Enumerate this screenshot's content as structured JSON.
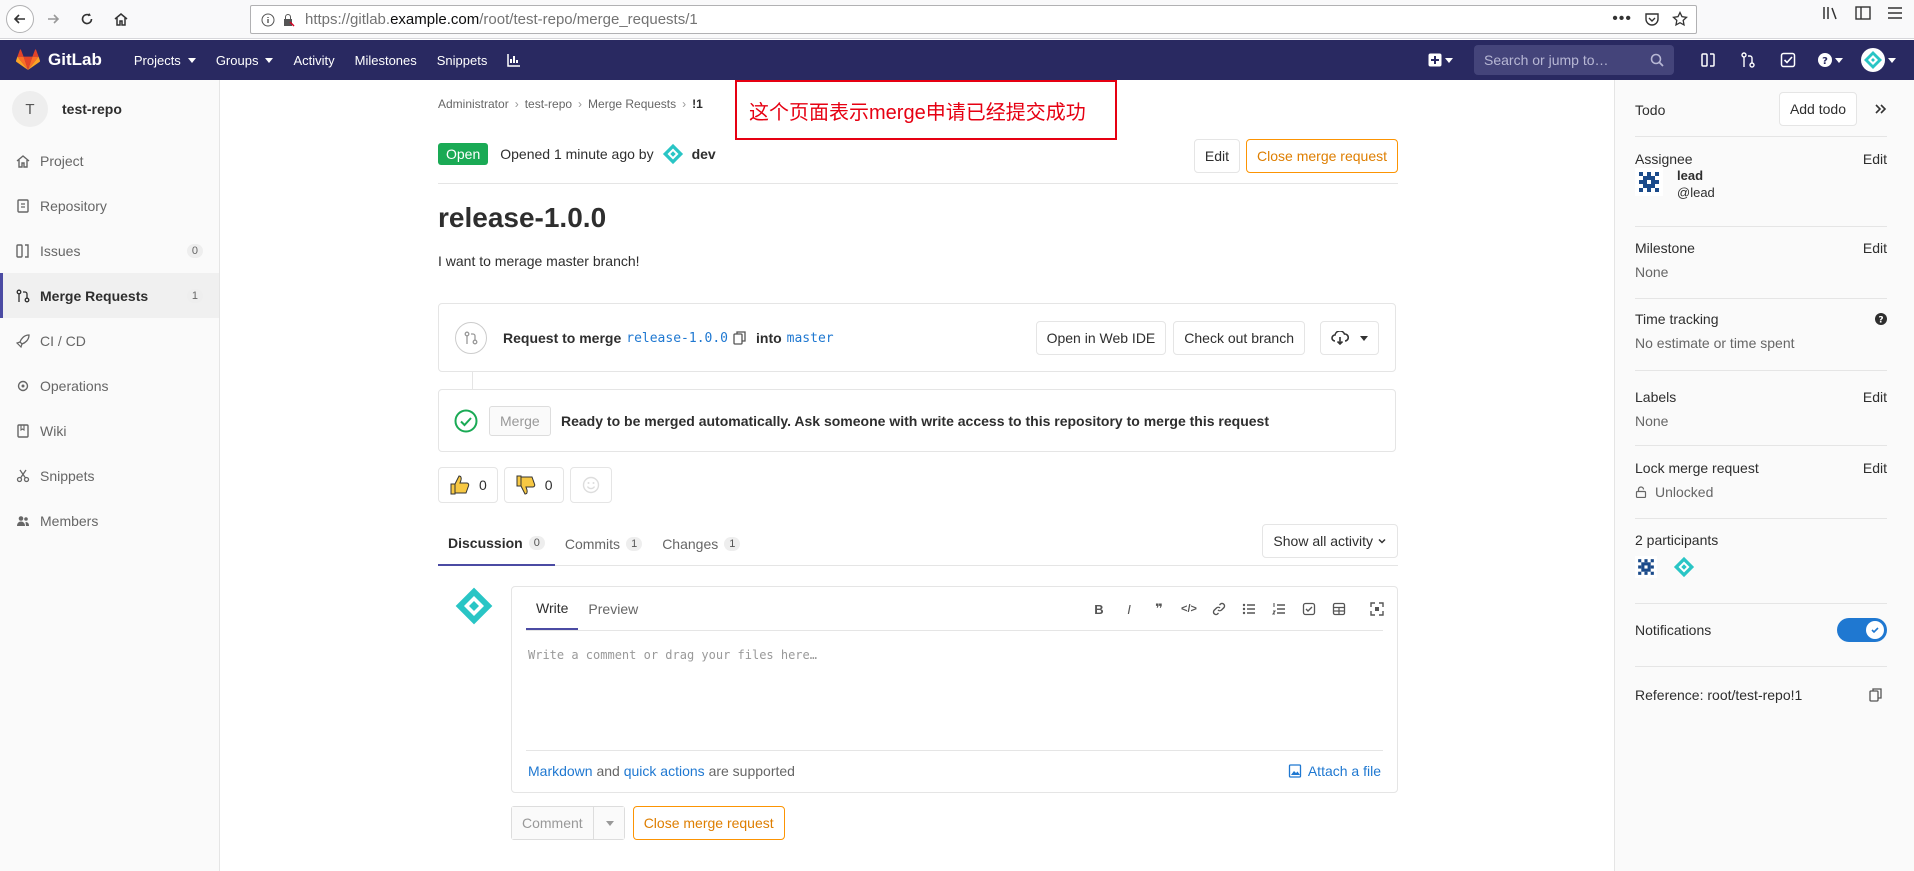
{
  "browser": {
    "url_prefix": "https://gitlab.",
    "url_host": "example.com",
    "url_path": "/root/test-repo/merge_requests/1"
  },
  "header": {
    "brand": "GitLab",
    "nav": [
      "Projects",
      "Groups",
      "Activity",
      "Milestones",
      "Snippets"
    ],
    "search_placeholder": "Search or jump to…"
  },
  "sidebar": {
    "project_initial": "T",
    "project_name": "test-repo",
    "items": [
      {
        "label": "Project"
      },
      {
        "label": "Repository"
      },
      {
        "label": "Issues",
        "count": "0"
      },
      {
        "label": "Merge Requests",
        "count": "1"
      },
      {
        "label": "CI / CD"
      },
      {
        "label": "Operations"
      },
      {
        "label": "Wiki"
      },
      {
        "label": "Snippets"
      },
      {
        "label": "Members"
      }
    ]
  },
  "breadcrumb": [
    "Administrator",
    "test-repo",
    "Merge Requests",
    "!1"
  ],
  "annotation": "这个页面表示merge申请已经提交成功",
  "mr": {
    "status": "Open",
    "opened_text": "Opened 1 minute ago by",
    "author": "dev",
    "edit_label": "Edit",
    "close_label": "Close merge request",
    "title": "release-1.0.0",
    "description": "I want to merage master branch!",
    "request_prefix": "Request to merge",
    "source_branch": "release-1.0.0",
    "into_label": "into",
    "target_branch": "master",
    "open_ide_label": "Open in Web IDE",
    "checkout_label": "Check out branch",
    "merge_label": "Merge",
    "merge_status": "Ready to be merged automatically. Ask someone with write access to this repository to merge this request",
    "thumbs_up": "0",
    "thumbs_down": "0"
  },
  "tabs": [
    {
      "label": "Discussion",
      "count": "0"
    },
    {
      "label": "Commits",
      "count": "1"
    },
    {
      "label": "Changes",
      "count": "1"
    }
  ],
  "activity_label": "Show all activity",
  "editor": {
    "write_label": "Write",
    "preview_label": "Preview",
    "placeholder": "Write a comment or drag your files here…",
    "markdown_label": "Markdown",
    "and_label": "and",
    "quick_actions_label": "quick actions",
    "supported_label": "are supported",
    "attach_label": "Attach a file",
    "comment_label": "Comment",
    "close_label": "Close merge request"
  },
  "right_sidebar": {
    "todo_label": "Todo",
    "add_todo_label": "Add todo",
    "assignee_label": "Assignee",
    "edit_label": "Edit",
    "assignee_name": "lead",
    "assignee_username": "@lead",
    "milestone_label": "Milestone",
    "milestone_value": "None",
    "time_tracking_label": "Time tracking",
    "time_tracking_value": "No estimate or time spent",
    "labels_label": "Labels",
    "labels_value": "None",
    "lock_label": "Lock merge request",
    "lock_value": "Unlocked",
    "participants_label": "2 participants",
    "notifications_label": "Notifications",
    "reference_label": "Reference: root/test-repo!1"
  },
  "colors": {
    "header_bg": "#292961",
    "open_badge": "#1aaa55",
    "warn": "#fc9403",
    "link": "#1f78d1",
    "annotation": "#e60012"
  }
}
